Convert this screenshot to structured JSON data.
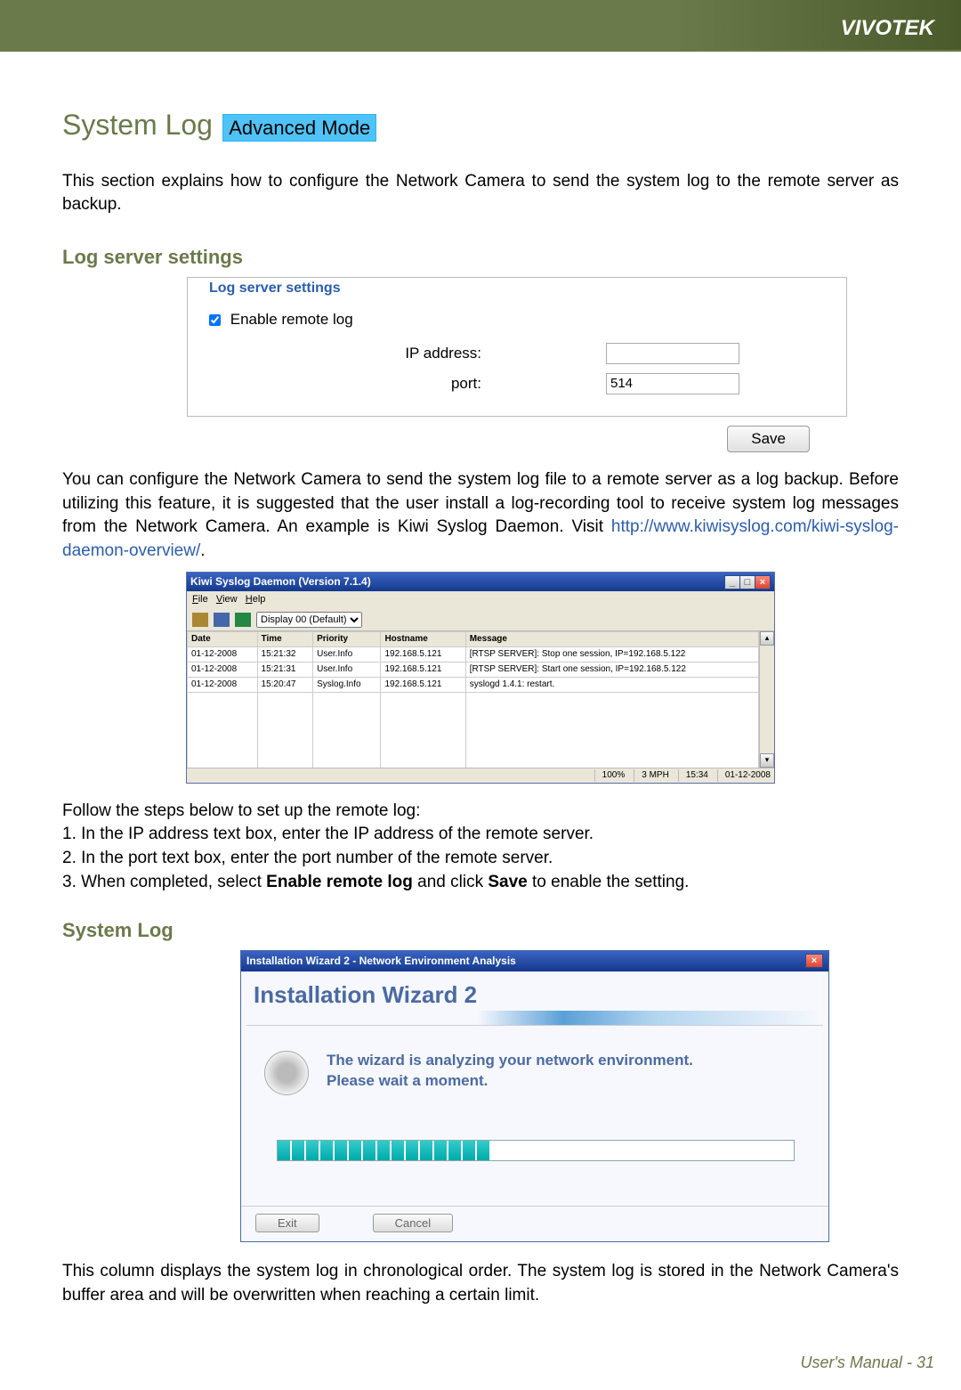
{
  "header": {
    "brand": "VIVOTEK"
  },
  "title": {
    "main": "System Log",
    "badge": "Advanced Mode"
  },
  "intro": "This section explains how to configure the Network Camera to send the system log to the remote server as backup.",
  "logserver": {
    "heading": "Log server settings",
    "legend": "Log server settings",
    "enable_label": "Enable remote log",
    "enable_checked": true,
    "ip_label": "IP address:",
    "ip_value": "",
    "port_label": "port:",
    "port_value": "514",
    "save_label": "Save"
  },
  "para1_text": "You can configure the Network Camera to send the system log file to a remote server as a log backup. Before utilizing this feature, it is suggested that the user install a log-recording tool to receive system log messages from the Network Camera. An example is Kiwi Syslog Daemon. Visit ",
  "para1_link": "http://www.kiwisyslog.com/kiwi-syslog-daemon-overview/",
  "para1_after": ".",
  "kiwi": {
    "title": "Kiwi Syslog Daemon (Version 7.1.4)",
    "menu": {
      "file": "File",
      "view": "View",
      "help": "Help"
    },
    "display_label": "Display 00 (Default)",
    "columns": [
      "Date",
      "Time",
      "Priority",
      "Hostname",
      "Message"
    ],
    "rows": [
      {
        "date": "01-12-2008",
        "time": "15:21:32",
        "pri": "User.Info",
        "host": "192.168.5.121",
        "msg": "[RTSP SERVER]: Stop one session, IP=192.168.5.122"
      },
      {
        "date": "01-12-2008",
        "time": "15:21:31",
        "pri": "User.Info",
        "host": "192.168.5.121",
        "msg": "[RTSP SERVER]: Start one session, IP=192.168.5.122"
      },
      {
        "date": "01-12-2008",
        "time": "15:20:47",
        "pri": "Syslog.Info",
        "host": "192.168.5.121",
        "msg": "syslogd 1.4.1: restart."
      }
    ],
    "status": {
      "pct": "100%",
      "rate": "3 MPH",
      "time": "15:34",
      "date": "01-12-2008"
    }
  },
  "steps": {
    "intro": "Follow the steps below to set up the remote log:",
    "s1": "1. In the IP address text box, enter the IP address of the remote server.",
    "s2": "2. In the port text box, enter the port number of the remote server.",
    "s3a": "3. When completed, select ",
    "s3b": "Enable remote log",
    "s3c": " and click ",
    "s3d": "Save",
    "s3e": " to enable the setting."
  },
  "systemlog": {
    "heading": "System Log",
    "wiz_title": "Installation Wizard 2 - Network Environment Analysis",
    "wiz_head": "Installation Wizard 2",
    "wiz_text1": "The wizard is analyzing your network environment.",
    "wiz_text2": "Please wait a moment.",
    "wiz_exit": "Exit",
    "wiz_cancel": "Cancel",
    "desc": "This column displays the system log in chronological order. The system log is stored in the Network Camera's buffer area and will be overwritten when reaching a certain limit."
  },
  "footer": {
    "manual": "User's Manual - ",
    "page": "31"
  }
}
